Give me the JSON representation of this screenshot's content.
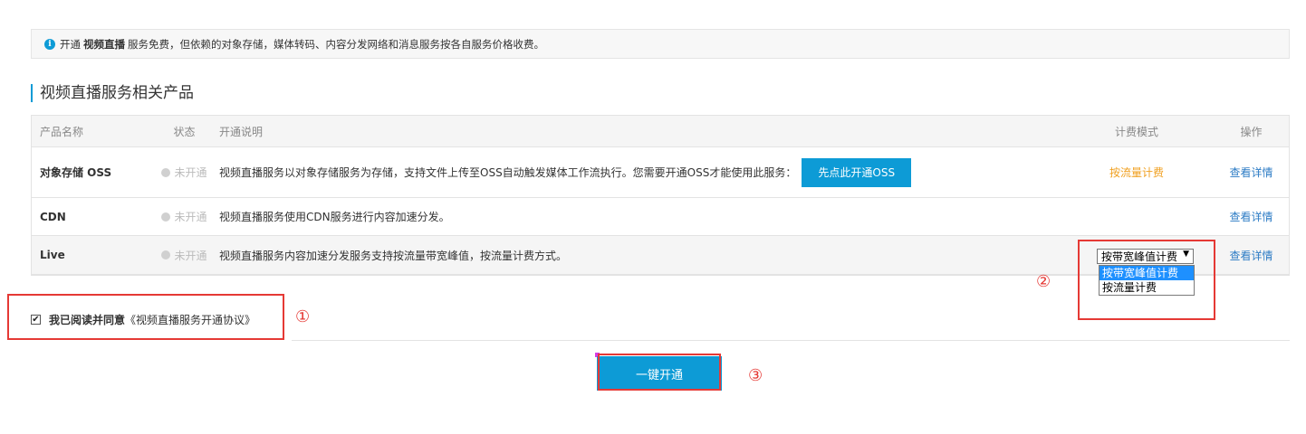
{
  "notice": {
    "prefix": "开通",
    "product": "视频直播",
    "text": "服务免费，但依赖的对象存储，媒体转码、内容分发网络和消息服务按各自服务价格收费。"
  },
  "section_title": "视频直播服务相关产品",
  "table": {
    "headers": [
      "产品名称",
      "状态",
      "开通说明",
      "计费模式",
      "操作"
    ],
    "rows": [
      {
        "name": "对象存储 OSS",
        "status": "未开通",
        "desc": "视频直播服务以对象存储服务为存储，支持文件上传至OSS自动触发媒体工作流执行。您需要开通OSS才能使用此服务：",
        "action_button": "先点此开通OSS",
        "billing": "按流量计费",
        "op": "查看详情"
      },
      {
        "name": "CDN",
        "status": "未开通",
        "desc": "视频直播服务使用CDN服务进行内容加速分发。",
        "billing": "",
        "op": "查看详情"
      },
      {
        "name": "Live",
        "status": "未开通",
        "desc": "视频直播服务内容加速分发服务支持按流量带宽峰值，按流量计费方式。",
        "op": "查看详情"
      }
    ]
  },
  "billing_select": {
    "selected": "按带宽峰值计费",
    "options": [
      "按带宽峰值计费",
      "按流量计费"
    ]
  },
  "agreement": {
    "checked": true,
    "label": "我已阅读并同意",
    "link": "《视频直播服务开通协议》"
  },
  "submit_button": "一键开通",
  "annotations": [
    "①",
    "②",
    "③"
  ],
  "colors": {
    "accent": "#0d9bd6",
    "highlight_box": "#e53935",
    "billing_text": "#f0a020",
    "link": "#2d7cc5"
  }
}
